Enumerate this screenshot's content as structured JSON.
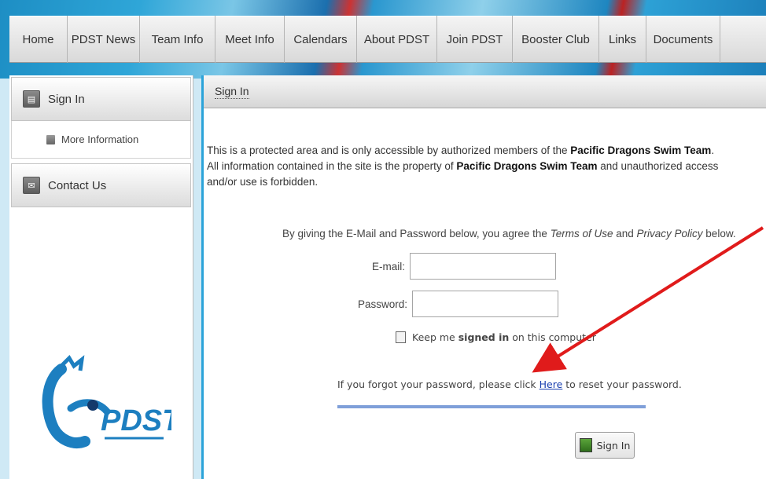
{
  "nav": {
    "items": [
      "Home",
      "PDST News",
      "Team Info",
      "Meet Info",
      "Calendars",
      "About PDST",
      "Join PDST",
      "Booster Club",
      "Links",
      "Documents"
    ]
  },
  "sidebar": {
    "sign_in": "Sign In",
    "more_info": "More Information",
    "contact": "Contact Us",
    "logo_text": "PDST"
  },
  "main": {
    "title": "Sign In",
    "intro_prefix": "This is a protected area and is only accessible by authorized members of the ",
    "team_name": "Pacific Dragons Swim Team",
    "intro_dot": ".",
    "intro_line2_prefix": "All information contained in the site is the property of ",
    "intro_line2_suffix": " and unauthorized access and/or use is forbidden.",
    "agree_prefix": "By giving the E-Mail and Password below, you agree the ",
    "terms": "Terms of Use",
    "agree_and": " and ",
    "privacy": "Privacy Policy",
    "agree_suffix": " below.",
    "email_label": "E-mail:",
    "email_value": "",
    "password_label": "Password:",
    "password_value": "",
    "keep_prefix": "Keep me ",
    "keep_bold": "signed in",
    "keep_suffix": " on this computer",
    "forgot_prefix": "If you forgot your password, please click ",
    "forgot_link": "Here",
    "forgot_suffix": " to reset your password.",
    "sign_in_button": "Sign In"
  },
  "colors": {
    "accent": "#2ba3d9",
    "link": "#1a3fb0",
    "annotation_arrow": "#e01b1b"
  }
}
